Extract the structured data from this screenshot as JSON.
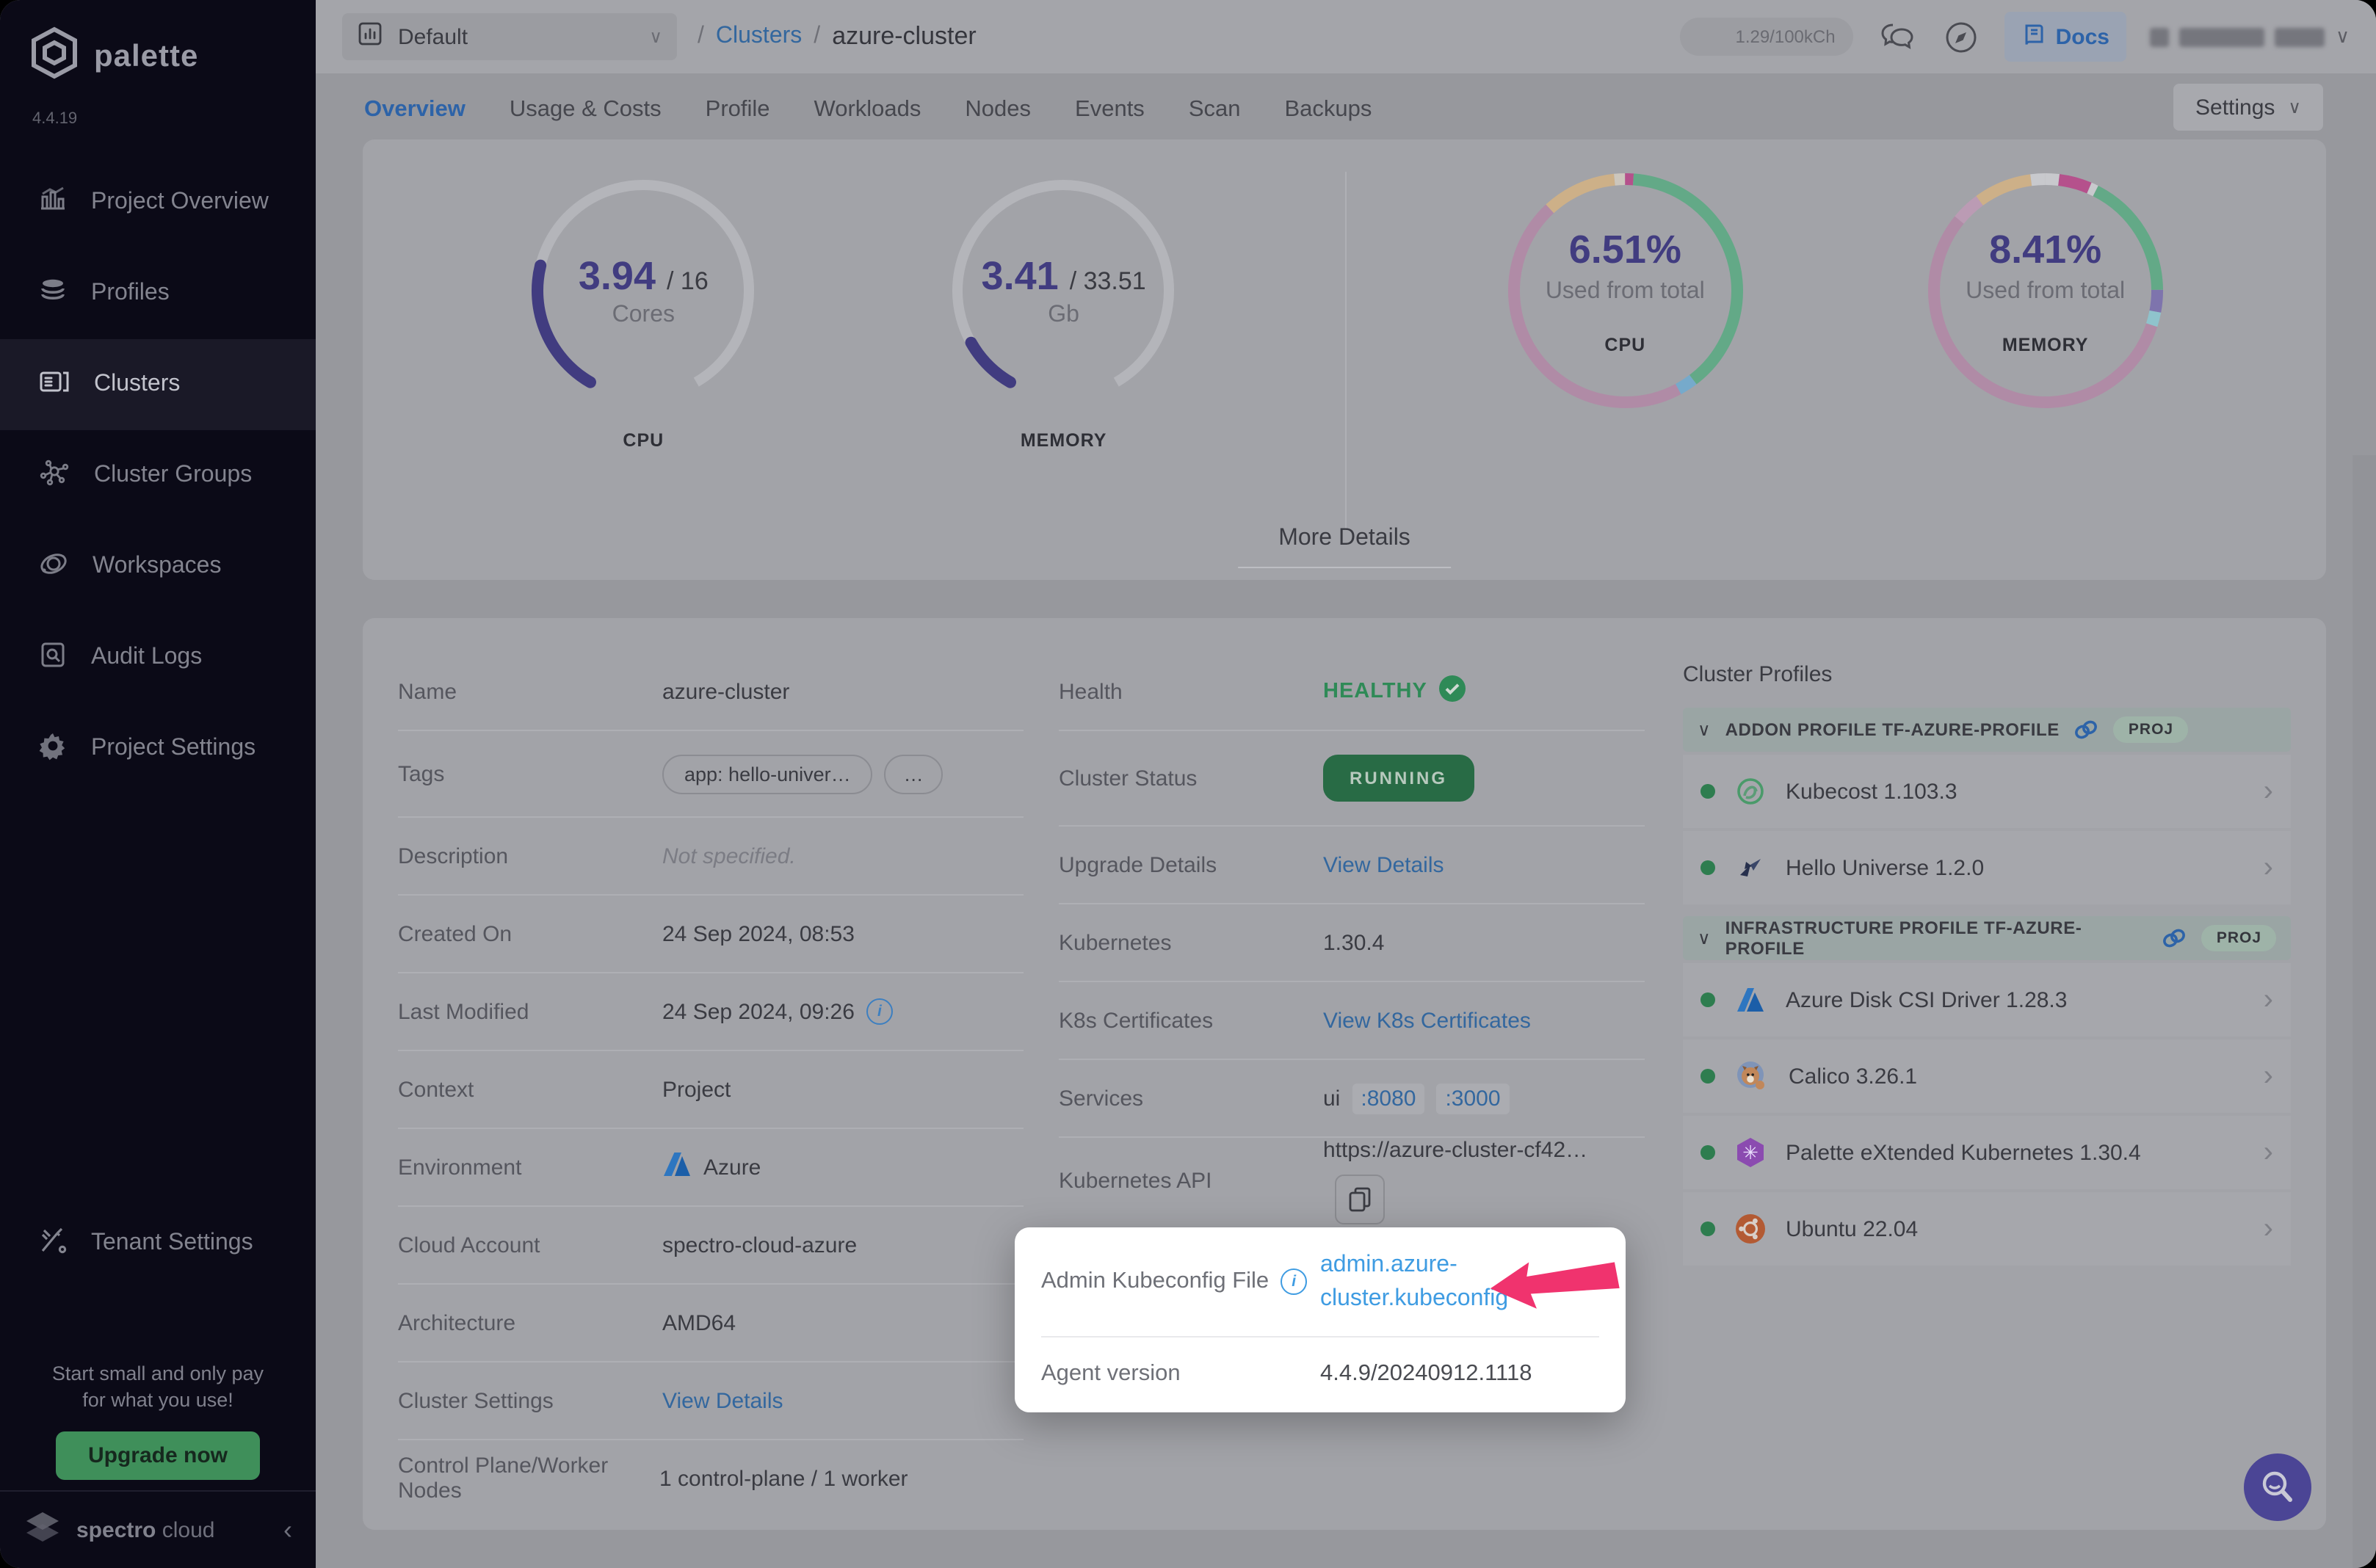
{
  "brand": {
    "name": "palette",
    "version": "4.4.19",
    "footer_brand": "spectro",
    "footer_brand2": "cloud"
  },
  "sidebar": {
    "items": [
      {
        "label": "Project Overview",
        "icon": "overview",
        "active": false
      },
      {
        "label": "Profiles",
        "icon": "profiles",
        "active": false
      },
      {
        "label": "Clusters",
        "icon": "clusters",
        "active": true
      },
      {
        "label": "Cluster Groups",
        "icon": "groups",
        "active": false
      },
      {
        "label": "Workspaces",
        "icon": "workspaces",
        "active": false
      },
      {
        "label": "Audit Logs",
        "icon": "audit",
        "active": false
      },
      {
        "label": "Project Settings",
        "icon": "settings",
        "active": false
      }
    ],
    "tenant_label": "Tenant Settings",
    "promo_line1": "Start small and only pay",
    "promo_line2": "for what you use!",
    "upgrade_label": "Upgrade now"
  },
  "topbar": {
    "project_selector": "Default",
    "breadcrumb_root": "Clusters",
    "breadcrumb_current": "azure-cluster",
    "usage": "1.29/100kCh",
    "docs_label": "Docs"
  },
  "tabs": {
    "items": [
      "Overview",
      "Usage & Costs",
      "Profile",
      "Workloads",
      "Nodes",
      "Events",
      "Scan",
      "Backups"
    ],
    "active": "Overview",
    "settings_label": "Settings"
  },
  "overview": {
    "cpu_gauge": {
      "value": "3.94",
      "total": "/ 16",
      "unit": "Cores",
      "label": "CPU",
      "fraction": 0.246
    },
    "memory_gauge": {
      "value": "3.41",
      "total": "/ 33.51",
      "unit": "Gb",
      "label": "MEMORY",
      "fraction": 0.102
    },
    "cpu_donut": {
      "pct": "6.51%",
      "caption": "Used from total",
      "label": "CPU",
      "segments": [
        {
          "color": "#b5518c",
          "frac": 1.2
        },
        {
          "color": "#63a987",
          "frac": 38.5
        },
        {
          "color": "#76aacb",
          "frac": 2.5
        },
        {
          "color": "#b08ba6",
          "frac": 46.0
        },
        {
          "color": "#cdb088",
          "frac": 10.3
        },
        {
          "color": "#ccc6bd",
          "frac": 1.5
        }
      ]
    },
    "memory_donut": {
      "pct": "8.41%",
      "caption": "Used from total",
      "label": "MEMORY",
      "segments": [
        {
          "color": "#c8c9cd",
          "frac": 2.0
        },
        {
          "color": "#b5518c",
          "frac": 4.5
        },
        {
          "color": "#c8c9cd",
          "frac": 1.0
        },
        {
          "color": "#63a987",
          "frac": 17.5
        },
        {
          "color": "#7e74ad",
          "frac": 3.0
        },
        {
          "color": "#8fc3cc",
          "frac": 2.0
        },
        {
          "color": "#b08ba6",
          "frac": 56.0
        },
        {
          "color": "#bb9bb4",
          "frac": 4.0
        },
        {
          "color": "#cdb088",
          "frac": 8.0
        },
        {
          "color": "#c8c9cd",
          "frac": 2.0
        }
      ]
    },
    "more_details_label": "More Details",
    "gauge_color": "#413c80",
    "gauge_track": "#b4b5ba"
  },
  "details": {
    "name_label": "Name",
    "name": "azure-cluster",
    "tags_label": "Tags",
    "tag1": "app: hello-univer…",
    "tag_more": "…",
    "description_label": "Description",
    "description": "Not specified.",
    "created_label": "Created On",
    "created": "24 Sep 2024, 08:53",
    "modified_label": "Last Modified",
    "modified": "24 Sep 2024, 09:26",
    "context_label": "Context",
    "context": "Project",
    "environment_label": "Environment",
    "environment": "Azure",
    "cloud_label": "Cloud Account",
    "cloud": "spectro-cloud-azure",
    "arch_label": "Architecture",
    "arch": "AMD64",
    "cluster_settings_label": "Cluster Settings",
    "cluster_settings_link": "View Details",
    "nodes_label": "Control Plane/Worker Nodes",
    "nodes": "1 control-plane / 1 worker",
    "health_label": "Health",
    "health": "HEALTHY",
    "status_label": "Cluster Status",
    "status": "RUNNING",
    "upgrade_label": "Upgrade Details",
    "upgrade_link": "View Details",
    "kubernetes_label": "Kubernetes",
    "kubernetes": "1.30.4",
    "certs_label": "K8s Certificates",
    "certs_link": "View K8s Certificates",
    "services_label": "Services",
    "services_name": "ui",
    "services_port1": ":8080",
    "services_port2": ":3000",
    "api_label": "Kubernetes API",
    "api": "https://azure-cluster-cf42…"
  },
  "spotlight": {
    "kubeconfig_label": "Admin Kubeconfig File",
    "kubeconfig_link_line1": "admin.azure-",
    "kubeconfig_link_line2": "cluster.kubeconfig",
    "agent_label": "Agent version",
    "agent_value": "4.4.9/20240912.1118",
    "arrow_color": "#f0336e"
  },
  "profiles": {
    "title": "Cluster Profiles",
    "badge": "PROJ",
    "groups": [
      {
        "title": "ADDON PROFILE TF-AZURE-PROFILE",
        "items": [
          {
            "name": "Kubecost 1.103.3",
            "logo": "kubecost"
          },
          {
            "name": "Hello Universe 1.2.0",
            "logo": "hello-universe"
          }
        ]
      },
      {
        "title": "INFRASTRUCTURE PROFILE TF-AZURE-PROFILE",
        "items": [
          {
            "name": "Azure Disk CSI Driver 1.28.3",
            "logo": "azure"
          },
          {
            "name": "Calico 3.26.1",
            "logo": "calico"
          },
          {
            "name": "Palette eXtended Kubernetes 1.30.4",
            "logo": "pxk"
          },
          {
            "name": "Ubuntu 22.04",
            "logo": "ubuntu"
          }
        ]
      }
    ]
  }
}
